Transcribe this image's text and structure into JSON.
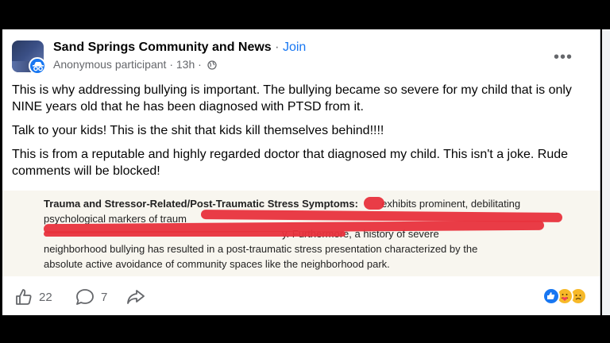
{
  "post": {
    "group_name": "Sand Springs Community and News",
    "separator": "·",
    "join_label": "Join",
    "author": "Anonymous participant",
    "time": "13h",
    "more_label": "•••",
    "paragraphs": [
      "This is why addressing bullying is important. The bullying became so severe for my child that is only NINE years old that he has been diagnosed with PTSD from it.",
      "Talk to your kids! This is the shit that kids kill themselves behind!!!!",
      "This is from a reputable and highly regarded doctor that diagnosed my child. This isn't a joke. Rude comments will be blocked!"
    ]
  },
  "document": {
    "heading": "Trauma and Stressor-Related/Post-Traumatic Stress Symptoms",
    "line1_tail": "exhibits prominent, debilitating",
    "line2": "psychological markers of traum",
    "line3_tail": "y. Furthermore, a history of severe",
    "line4": "neighborhood bullying has resulted in a post-traumatic stress presentation characterized by the",
    "line5": "absolute active avoidance of community spaces like the neighborhood park."
  },
  "actions": {
    "like_count": "22",
    "comment_count": "7"
  },
  "icons": [
    "like-icon",
    "comment-icon",
    "share-icon",
    "globe-icon",
    "more-icon",
    "anonymous-icon"
  ],
  "colors": {
    "accent": "#1877f2",
    "redaction": "#e8323c"
  }
}
